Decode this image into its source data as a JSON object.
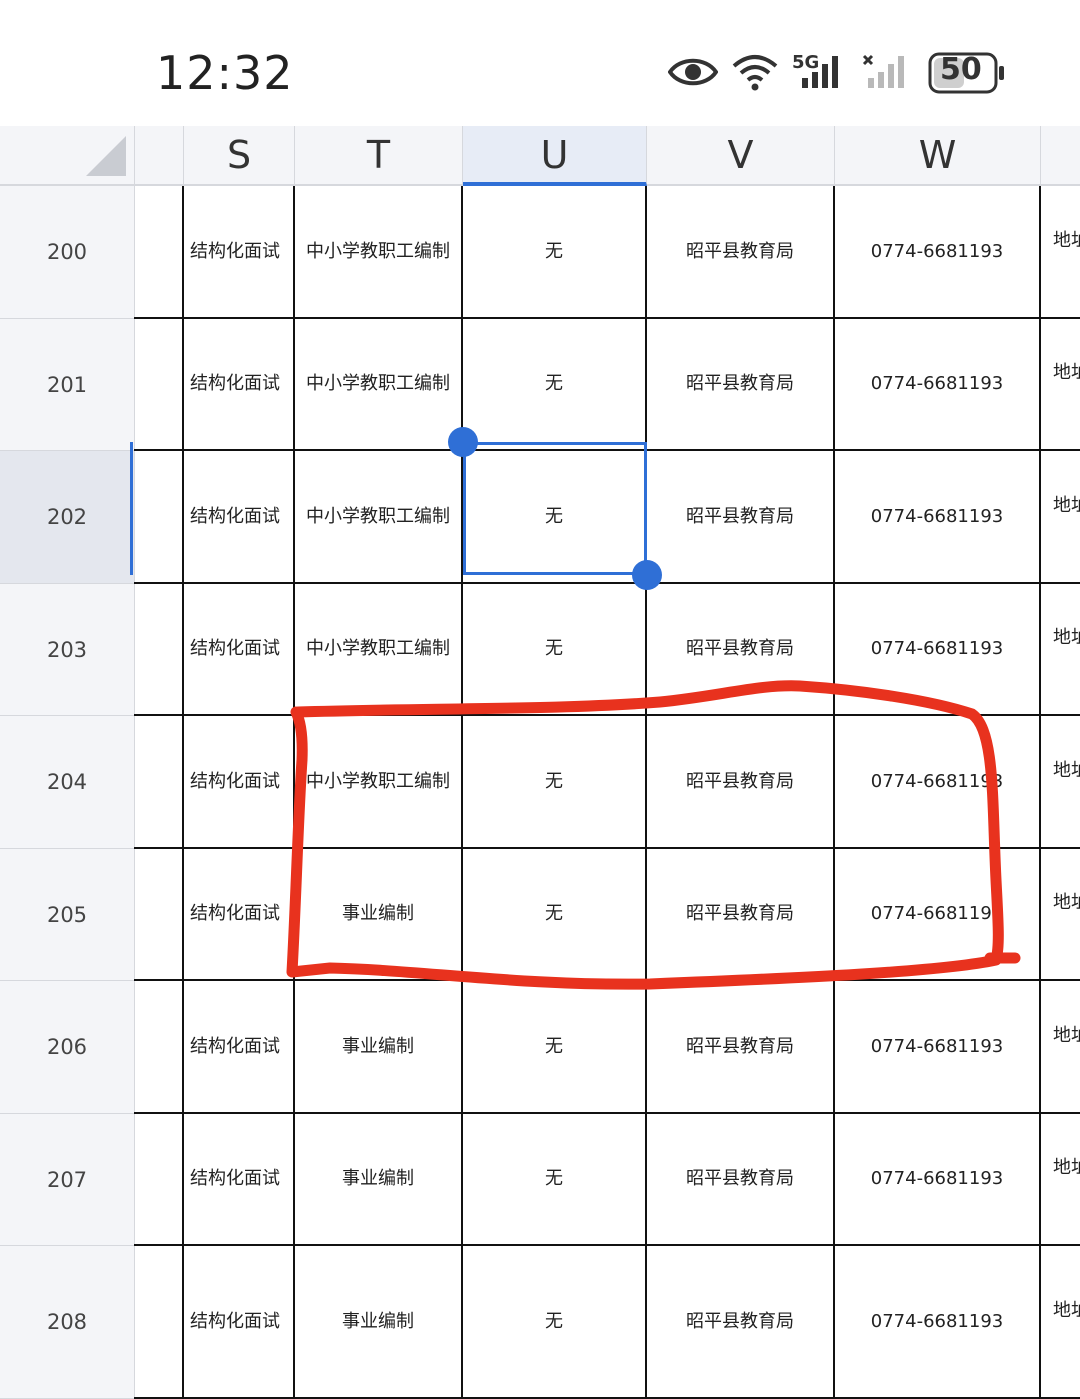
{
  "status_bar": {
    "time": "12:32",
    "icons": [
      "eye-icon",
      "wifi-icon",
      "signal-5g-icon",
      "signal-no-service-icon",
      "battery-icon"
    ],
    "network_label": "5G",
    "battery_level": "50"
  },
  "sheet": {
    "columns": [
      "S",
      "T",
      "U",
      "V",
      "W"
    ],
    "selected_column": "U",
    "selected_row": "202",
    "rows": [
      {
        "num": "200",
        "S": "结构化面试",
        "T": "中小学教职工编制",
        "U": "无",
        "V": "昭平县教育局",
        "W": "0774-6681193",
        "X": "地址"
      },
      {
        "num": "201",
        "S": "结构化面试",
        "T": "中小学教职工编制",
        "U": "无",
        "V": "昭平县教育局",
        "W": "0774-6681193",
        "X": "地址"
      },
      {
        "num": "202",
        "S": "结构化面试",
        "T": "中小学教职工编制",
        "U": "无",
        "V": "昭平县教育局",
        "W": "0774-6681193",
        "X": "地址"
      },
      {
        "num": "203",
        "S": "结构化面试",
        "T": "中小学教职工编制",
        "U": "无",
        "V": "昭平县教育局",
        "W": "0774-6681193",
        "X": "地址"
      },
      {
        "num": "204",
        "S": "结构化面试",
        "T": "中小学教职工编制",
        "U": "无",
        "V": "昭平县教育局",
        "W": "0774-6681193",
        "X": "地址"
      },
      {
        "num": "205",
        "S": "结构化面试",
        "T": "事业编制",
        "U": "无",
        "V": "昭平县教育局",
        "W": "0774-6681193",
        "X": "地址"
      },
      {
        "num": "206",
        "S": "结构化面试",
        "T": "事业编制",
        "U": "无",
        "V": "昭平县教育局",
        "W": "0774-6681193",
        "X": "地址"
      },
      {
        "num": "207",
        "S": "结构化面试",
        "T": "事业编制",
        "U": "无",
        "V": "昭平县教育局",
        "W": "0774-6681193",
        "X": "地址"
      },
      {
        "num": "208",
        "S": "结构化面试",
        "T": "事业编制",
        "U": "无",
        "V": "昭平县教育局",
        "W": "0774-6681193",
        "X": "地址"
      }
    ]
  },
  "colors": {
    "selection": "#2f6fd6",
    "annotation": "#e8321e",
    "header_bg": "#f4f5f8"
  }
}
